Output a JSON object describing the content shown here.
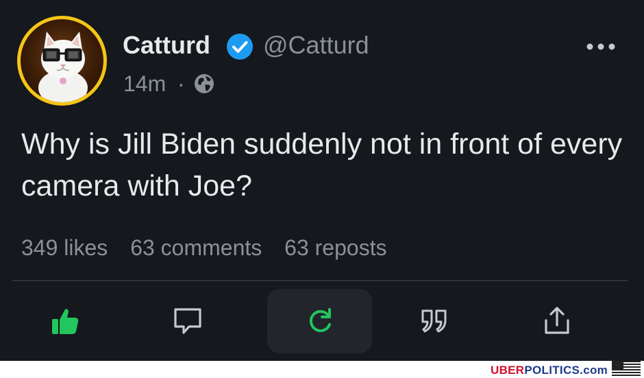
{
  "post": {
    "author_name": "Catturd",
    "handle": "@Catturd",
    "time": "14m",
    "separator": "·",
    "visibility_icon": "globe-icon",
    "verified_icon": "verified-badge-icon",
    "text": "Why is Jill Biden suddenly not in front of every camera with Joe?",
    "stats": {
      "likes": "349 likes",
      "comments": "63 comments",
      "reposts": "63 reposts"
    }
  },
  "actions": [
    {
      "name": "like",
      "icon": "thumbs-up-icon",
      "active": true,
      "color": "#22c55e"
    },
    {
      "name": "comment",
      "icon": "comment-icon",
      "active": false
    },
    {
      "name": "repost",
      "icon": "refresh-icon",
      "active": true,
      "color": "#22c55e"
    },
    {
      "name": "quote",
      "icon": "quote-icon",
      "active": false
    },
    {
      "name": "share",
      "icon": "share-icon",
      "active": false
    }
  ],
  "watermark": {
    "part1": "UBER",
    "part2": "POLITICS.com"
  },
  "colors": {
    "background": "#15181d",
    "text": "#e7e9ea",
    "muted": "#8b9198",
    "accent_green": "#22c55e",
    "verified_blue": "#1d9bf0",
    "avatar_ring": "#f5c518"
  }
}
